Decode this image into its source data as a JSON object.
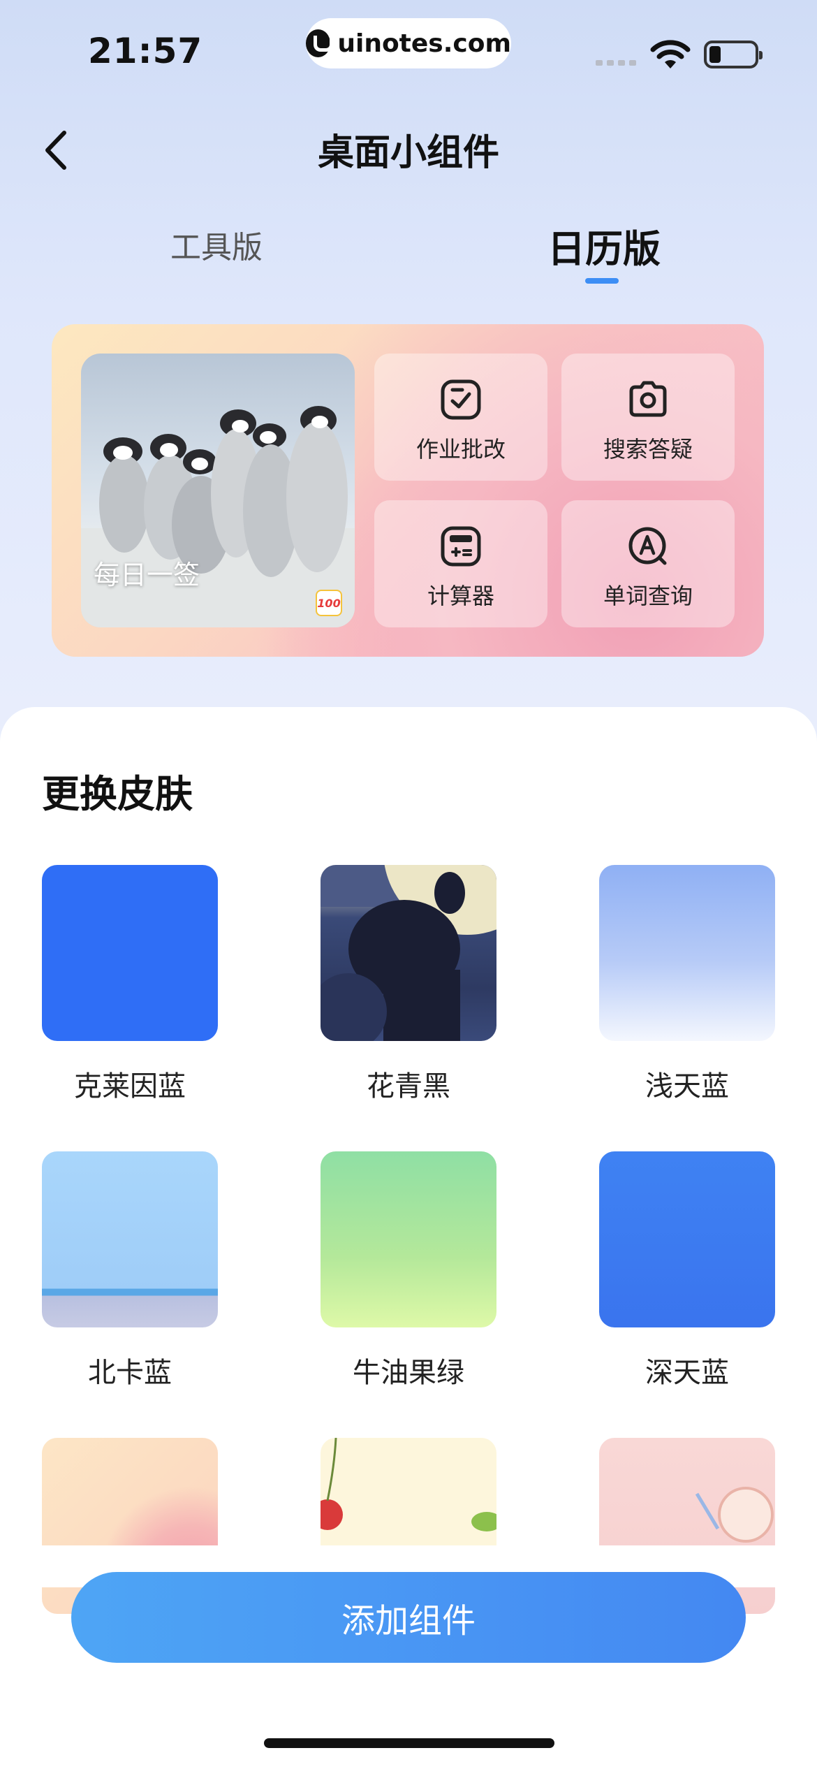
{
  "status": {
    "time": "21:57",
    "url": "uinotes.com"
  },
  "nav": {
    "title": "桌面小组件"
  },
  "tabs": [
    {
      "label": "工具版",
      "active": false
    },
    {
      "label": "日历版",
      "active": true
    }
  ],
  "widget": {
    "photo_label": "每日一签",
    "logo_text": "100",
    "tools": [
      {
        "label": "作业批改",
        "icon": "homework-check-icon"
      },
      {
        "label": "搜索答疑",
        "icon": "camera-icon"
      },
      {
        "label": "计算器",
        "icon": "calculator-icon"
      },
      {
        "label": "单词查询",
        "icon": "word-search-icon"
      }
    ]
  },
  "skins_title": "更换皮肤",
  "skins": [
    {
      "label": "克莱因蓝",
      "color": "#2f6ef6"
    },
    {
      "label": "花青黑",
      "color": "#3c4a74"
    },
    {
      "label": "浅天蓝",
      "color": "#9bb8f5"
    },
    {
      "label": "北卡蓝",
      "color": "#a8d4fa"
    },
    {
      "label": "牛油果绿",
      "color": "#a6e49a"
    },
    {
      "label": "深天蓝",
      "color": "#3d7af0"
    },
    {
      "label": "",
      "color": "#fbe0c8"
    },
    {
      "label": "",
      "color": "#fdf6dc"
    },
    {
      "label": "",
      "color": "#f8d6d6"
    }
  ],
  "add_button": "添加组件",
  "colors": {
    "accent": "#4a94f4",
    "tab_indicator": "#3d8ef5"
  }
}
